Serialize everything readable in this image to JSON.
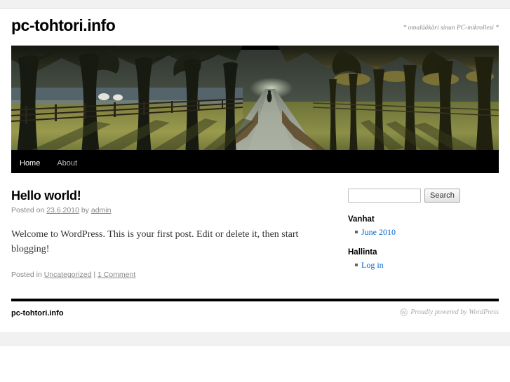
{
  "site": {
    "title": "pc-tohtori.info",
    "description": "* omalääkäri sinun PC-mikrollesi *"
  },
  "nav": {
    "items": [
      {
        "label": "Home",
        "current": true
      },
      {
        "label": "About",
        "current": false
      }
    ]
  },
  "header_image": {
    "alt": "tree-lined path with fence",
    "name": "path-header-image"
  },
  "post": {
    "title": "Hello world!",
    "meta_prefix": "Posted on ",
    "date": "23.6.2010",
    "meta_by": " by ",
    "author": "admin",
    "body": "Welcome to WordPress. This is your first post. Edit or delete it, then start blogging!",
    "utility_prefix": "Posted in ",
    "category": "Uncategorized",
    "utility_sep": " | ",
    "comments": "1 Comment"
  },
  "sidebar": {
    "search": {
      "value": "",
      "placeholder": "",
      "button_label": "Search"
    },
    "widgets": [
      {
        "title": "Vanhat",
        "items": [
          "June 2010"
        ]
      },
      {
        "title": "Hallinta",
        "items": [
          "Log in"
        ]
      }
    ]
  },
  "footer": {
    "site_info": "pc-tohtori.info",
    "generator": "Proudly powered by WordPress",
    "generator_icon": "wordpress-logo-icon"
  },
  "colors": {
    "link": "#0066cc",
    "nav_background": "#000000",
    "nav_active_text": "#ffffff",
    "nav_text": "#bbbbbb",
    "muted_text": "#888888",
    "page_background": "#ffffff",
    "strip_background": "#f1f1f1"
  }
}
